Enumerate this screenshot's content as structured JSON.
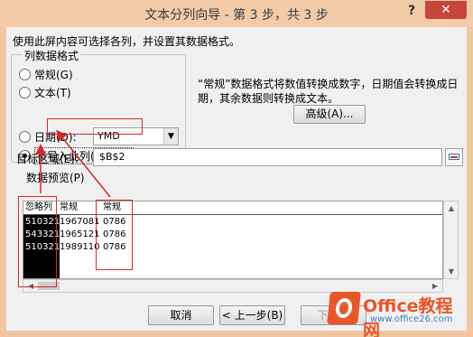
{
  "window": {
    "title": "文本分列向导 - 第 3 步，共 3 步",
    "help_glyph": "?",
    "close_glyph": "✕"
  },
  "instruction": "使用此屏内容可选择各列，并设置其数据格式。",
  "column_format": {
    "legend": "列数据格式",
    "options": [
      {
        "label": "常规(G)",
        "checked": false
      },
      {
        "label": "文本(T)",
        "checked": false
      },
      {
        "label": "日期(D):",
        "checked": false
      },
      {
        "label": "不导入此列(跳过)(I)",
        "checked": true
      }
    ],
    "date_format": "YMD"
  },
  "description": "“常规”数据格式将数值转换成数字，日期值会转换成日期，其余数据则转换成文本。",
  "advanced_button": "高级(A)...",
  "target": {
    "label": "目标区域(E):",
    "value": "$B$2"
  },
  "preview": {
    "label": "数据预览(P)",
    "headers": [
      "忽略列",
      "常规",
      "常规"
    ],
    "rows": [
      [
        "510321",
        "1967081",
        "0786"
      ],
      [
        "543321",
        "1965121",
        "0786"
      ],
      [
        "510321",
        "1989110",
        "0786"
      ]
    ]
  },
  "buttons": {
    "cancel": "取消",
    "back": "< 上一步(B)",
    "next": "下一步"
  },
  "watermark": {
    "brand": "Office教程网",
    "url": "www.office26.com"
  },
  "colors": {
    "frame": "#f0c6a0",
    "close": "#c7463c",
    "annotation": "#d22b2b",
    "logo": "#e8562a"
  }
}
